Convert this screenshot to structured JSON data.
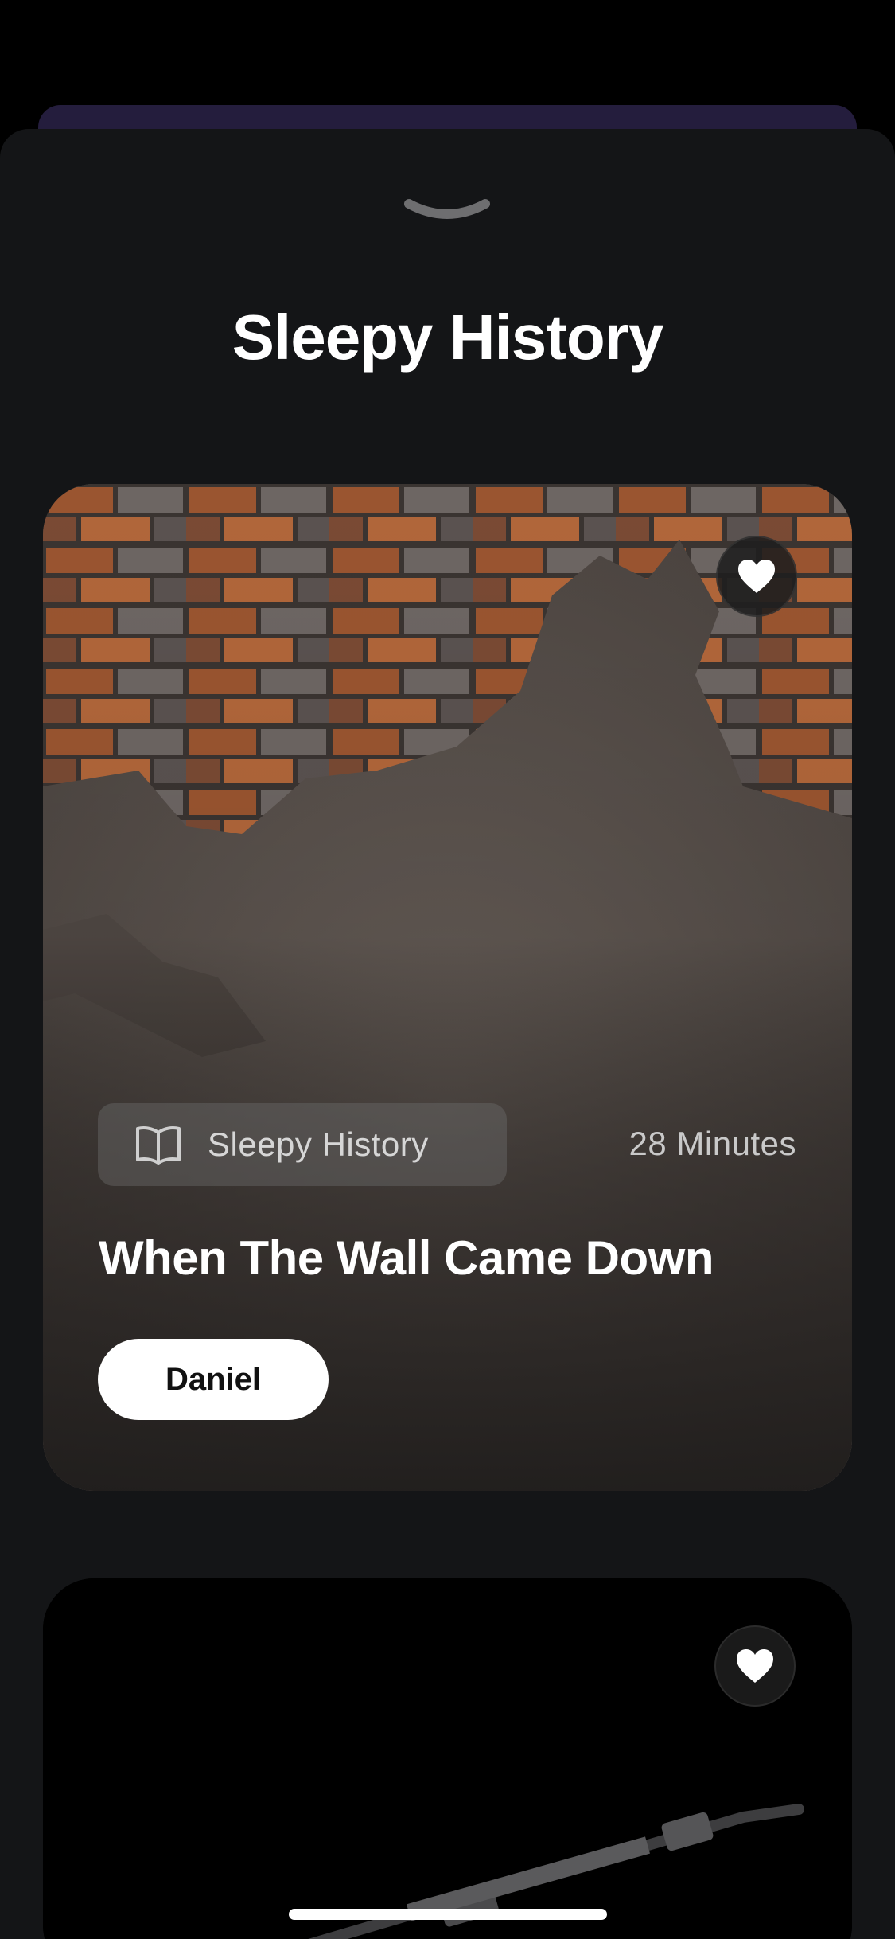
{
  "header": {
    "title": "Sleepy History"
  },
  "stories": [
    {
      "category": "Sleepy History",
      "category_icon": "book-open-icon",
      "duration": "28 Minutes",
      "title": "When The Wall Came Down",
      "narrator": "Daniel",
      "favorite_icon": "heart-icon"
    },
    {
      "favorite_icon": "heart-icon"
    }
  ],
  "colors": {
    "background": "#000000",
    "sheet": "#141517",
    "behind_sheet": "#241d3d",
    "text_primary": "#ffffff",
    "button_background": "#ffffff"
  }
}
